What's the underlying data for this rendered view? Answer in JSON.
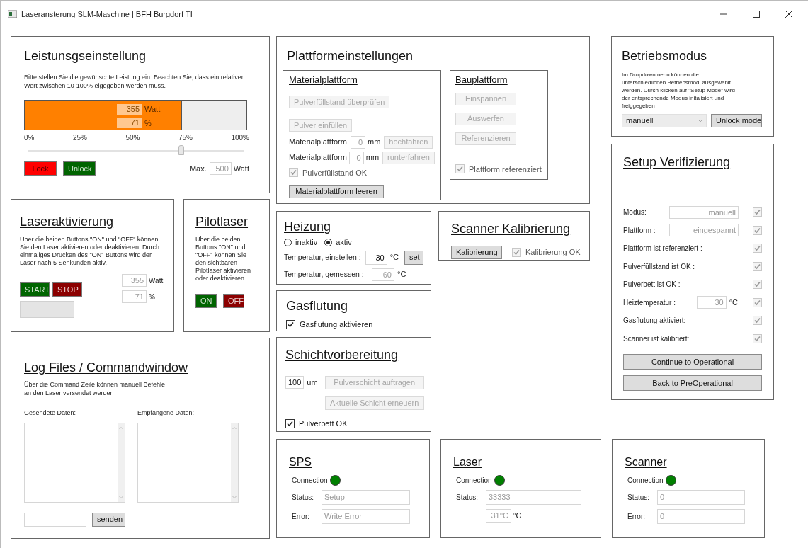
{
  "window": {
    "title": "Laseransterung SLM-Maschine | BFH Burgdorf TI"
  },
  "leistung": {
    "title": "Leistunsgseinstellung",
    "description": "Bitte stellen Sie die gewünschte Leistung ein. Beachten Sie, dass ein relativer Wert zwischen 10-100% eigegeben werden muss.",
    "bar": {
      "level": 0.71
    },
    "watt": {
      "value": "355",
      "unit": "Watt"
    },
    "percent": {
      "value": "71",
      "unit": "%"
    },
    "scale": [
      "0%",
      "25%",
      "50%",
      "75%",
      "100%"
    ],
    "slider": {
      "level": 0.71
    },
    "buttons": [
      {
        "label": "Lock",
        "color": "#ff0000"
      },
      {
        "label": "Unlock",
        "color": "#006400"
      }
    ],
    "max": {
      "label": "Max.",
      "value": "500",
      "unit": "Watt"
    }
  },
  "laseraktivierung": {
    "title": "Laseraktivierung",
    "description": "Über die beiden Buttons \"ON\" und \"OFF\" können Sie den Laser aktivieren oder deaktivieren. Durch einmaliges Drücken des \"ON\" Buttons wird der Laser nach 5 Senkunden aktiv.",
    "buttons": [
      {
        "label": "START",
        "color": "#006400"
      },
      {
        "label": "STOP",
        "color": "#8b0000"
      }
    ],
    "watt": {
      "value": "355",
      "unit": "Watt"
    },
    "percent": {
      "value": "71",
      "unit": "%"
    }
  },
  "pilotlaser": {
    "title": "Pilotlaser",
    "description": "Über die beiden Buttons \"ON\" und \"OFF\" können Sie den sichtbaren Pilotlaser aktivieren oder deaktivieren.",
    "buttons": [
      {
        "label": "ON",
        "color": "#006400"
      },
      {
        "label": "OFF",
        "color": "#8b0000"
      }
    ]
  },
  "log": {
    "title": "Log Files / Commandwindow",
    "description": [
      "Über die Command Zeile können manuell Befehle",
      "an den Laser versendet werden"
    ],
    "sent_label": "Gesendete Daten:",
    "received_label": "Empfangene Daten:",
    "send_button": "senden"
  },
  "plattform": {
    "title": "Plattformeinstellungen",
    "material": {
      "title": "Materialplattform",
      "check_button": {
        "label": "Pulverfüllstand überprüfen",
        "disabled": true
      },
      "fill_button": {
        "label": "Pulver einfüllen",
        "disabled": true
      },
      "rows": [
        {
          "label": "Materialplattform",
          "value": "0",
          "unit": "mm",
          "button": {
            "label": "hochfahren",
            "disabled": true
          }
        },
        {
          "label": "Materialplattform",
          "value": "0",
          "unit": "mm",
          "button": {
            "label": "runterfahren",
            "disabled": true
          }
        }
      ],
      "checkbox": {
        "label": "Pulverfüllstand OK",
        "checked": true,
        "disabled": true
      },
      "empty_button": {
        "label": "Materialplattform leeren",
        "disabled": false
      }
    },
    "bau": {
      "title": "Bauplattform",
      "buttons": [
        {
          "label": "Einspannen",
          "disabled": true
        },
        {
          "label": "Auswerfen",
          "disabled": true
        },
        {
          "label": "Referenzieren",
          "disabled": true
        }
      ],
      "checkbox": {
        "label": "Plattform referenziert",
        "checked": true,
        "disabled": true
      }
    }
  },
  "heizung": {
    "title": "Heizung",
    "radios": [
      {
        "label": "inaktiv",
        "selected": false
      },
      {
        "label": "aktiv",
        "selected": true
      }
    ],
    "set": {
      "label": "Temperatur, einstellen :",
      "value": "30",
      "readonly": false,
      "unit": "°C",
      "button": {
        "label": "set",
        "disabled": false
      }
    },
    "measured": {
      "label": "Temperatur, gemessen :",
      "value": "60",
      "readonly": true,
      "unit": "°C"
    }
  },
  "gasflutung": {
    "title": "Gasflutung",
    "checkbox": {
      "label": "Gasflutung aktivieren",
      "checked": true,
      "disabled": false
    }
  },
  "schicht": {
    "title": "Schichtvorbereitung",
    "value": "100",
    "unit": "um",
    "buttons": [
      {
        "label": "Pulverschicht auftragen",
        "disabled": true
      },
      {
        "label": "Aktuelle Schicht erneuern",
        "disabled": true
      }
    ],
    "checkbox": {
      "label": "Pulverbett OK",
      "checked": true,
      "disabled": false
    }
  },
  "scanner_kalibrierung": {
    "title": "Scanner Kalibrierung",
    "button": {
      "label": "Kalibrierung",
      "disabled": false
    },
    "checkbox": {
      "label": "Kalibrierung OK",
      "checked": true,
      "disabled": true
    }
  },
  "betriebsmodus": {
    "title": "Betriebsmodus",
    "description": "Im Dropdownmenu können die unterschiedlichen Betriebsmodi ausgewählt werden. Durch klicken auf \"Setup Mode\" wird der entsprechende Modus initalisiert und freiggegeben",
    "dropdown": "manuell",
    "button": {
      "label": "Unlock mode",
      "disabled": false
    }
  },
  "setup": {
    "title": "Setup Verifizierung",
    "rows": [
      {
        "kind": "field",
        "label": "Modus:",
        "value": "manuell",
        "check": {
          "checked": true,
          "disabled": true
        }
      },
      {
        "kind": "field",
        "label": "Plattform :",
        "value": "eingespannt",
        "check": {
          "checked": true,
          "disabled": true
        }
      },
      {
        "kind": "plain",
        "label": "Plattform ist referenziert :",
        "check": {
          "checked": true,
          "disabled": true
        }
      },
      {
        "kind": "plain",
        "label": "Pulverfüllstand ist OK :",
        "check": {
          "checked": true,
          "disabled": true
        }
      },
      {
        "kind": "plain",
        "label": "Pulverbett ist OK :",
        "check": {
          "checked": true,
          "disabled": true
        }
      },
      {
        "kind": "temp",
        "label": "Heiztemperatur :",
        "value": "30",
        "unit": "°C",
        "check": {
          "checked": true,
          "disabled": true
        }
      },
      {
        "kind": "plain",
        "label": "Gasflutung aktiviert:",
        "check": {
          "checked": true,
          "disabled": true
        }
      },
      {
        "kind": "plain",
        "label": "Scanner ist kalibriert:",
        "check": {
          "checked": true,
          "disabled": true
        }
      }
    ],
    "buttons": [
      {
        "label": "Continue to Operational",
        "disabled": false
      },
      {
        "label": "Back to PreOperational",
        "disabled": false
      }
    ]
  },
  "devices": [
    {
      "title": "SPS",
      "connection": "Connection",
      "color": "#008000",
      "fields": [
        {
          "label": "Status:",
          "value": "Setup"
        },
        {
          "label": "Error:",
          "value": "Write Error"
        }
      ]
    },
    {
      "title": "Laser",
      "connection": "Connection",
      "color": "#008000",
      "fields": [
        {
          "label": "Status:",
          "value": "33333"
        }
      ],
      "temperature": {
        "value": "31°C",
        "unit": "°C"
      }
    },
    {
      "title": "Scanner",
      "connection": "Connection",
      "color": "#008000",
      "fields": [
        {
          "label": "Status:",
          "value": "0"
        },
        {
          "label": "Error:",
          "value": "0"
        }
      ]
    }
  ]
}
